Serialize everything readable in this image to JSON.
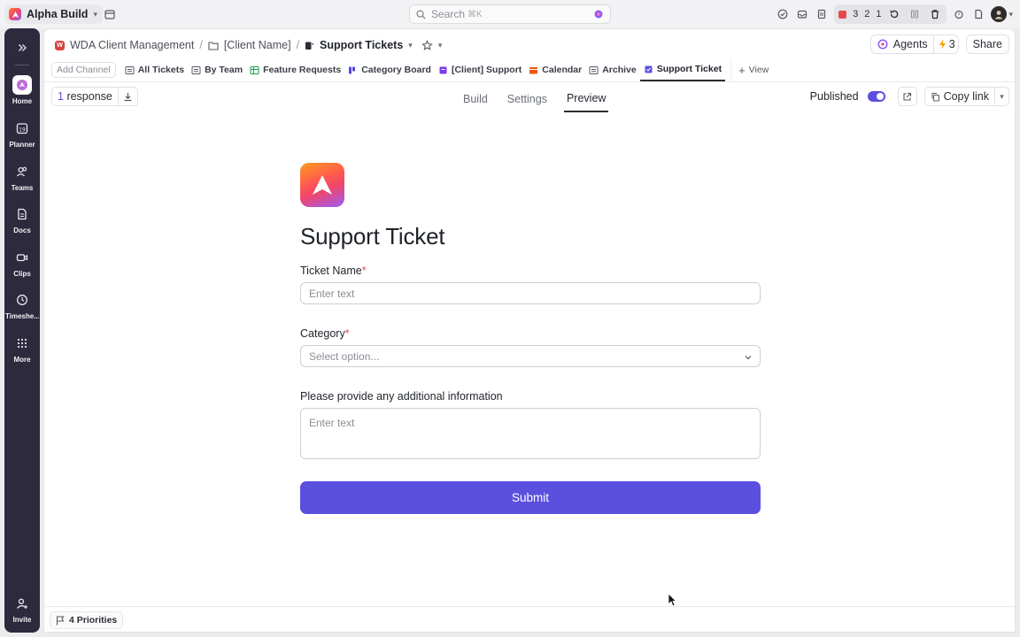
{
  "topbar": {
    "workspace": "Alpha Build",
    "search_placeholder": "Search",
    "search_shortcut": "⌘K",
    "timers": [
      "3",
      "2",
      "1"
    ]
  },
  "rail": {
    "items": [
      {
        "label": "Home"
      },
      {
        "label": "Planner"
      },
      {
        "label": "Teams"
      },
      {
        "label": "Docs"
      },
      {
        "label": "Clips"
      },
      {
        "label": "Timeshe..."
      },
      {
        "label": "More"
      }
    ],
    "invite": "Invite"
  },
  "breadcrumb": {
    "space": "WDA Client Management",
    "folder": "[Client Name]",
    "list": "Support Tickets"
  },
  "header": {
    "agents": "Agents",
    "bolt_count": "3",
    "share": "Share"
  },
  "views": {
    "add_channel": "Add Channel",
    "tabs": [
      {
        "label": "All Tickets"
      },
      {
        "label": "By Team"
      },
      {
        "label": "Feature Requests"
      },
      {
        "label": "Category Board"
      },
      {
        "label": "[Client] Support"
      },
      {
        "label": "Calendar"
      },
      {
        "label": "Archive"
      },
      {
        "label": "Support Ticket"
      }
    ],
    "add_view": "View"
  },
  "form_toolbar": {
    "response_count": "1",
    "response_word": "response",
    "tabs": [
      "Build",
      "Settings",
      "Preview"
    ],
    "published": "Published",
    "copy_link": "Copy link"
  },
  "form": {
    "title": "Support Ticket",
    "fields": [
      {
        "label": "Ticket Name",
        "required": "*",
        "placeholder": "Enter text"
      },
      {
        "label": "Category",
        "required": "*",
        "placeholder": "Select option..."
      },
      {
        "label": "Please provide any additional information",
        "placeholder": "Enter text"
      }
    ],
    "submit": "Submit"
  },
  "footer": {
    "priorities": "4 Priorities"
  },
  "colors": {
    "accent": "#5b4fe0",
    "rail": "#2d2a3e",
    "required": "#e5484d"
  }
}
